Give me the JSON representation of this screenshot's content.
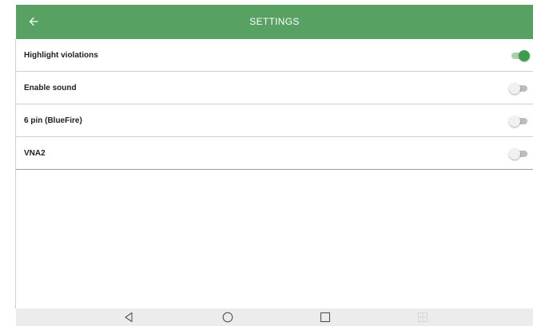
{
  "appbar": {
    "title": "SETTINGS",
    "back_icon": "arrow-left-icon",
    "background": "#57a163"
  },
  "settings": [
    {
      "label": "Highlight violations",
      "enabled": true
    },
    {
      "label": "Enable sound",
      "enabled": false
    },
    {
      "label": "6 pin (BlueFire)",
      "enabled": false
    },
    {
      "label": "VNA2",
      "enabled": false
    }
  ],
  "navbar": {
    "buttons": [
      "back-triangle-icon",
      "home-circle-icon",
      "recents-square-icon",
      "split-screen-icon"
    ]
  },
  "colors": {
    "accent": "#3e9d4d",
    "switch_on_track": "#a6d3ad",
    "switch_off_track": "#bdbdbd"
  }
}
